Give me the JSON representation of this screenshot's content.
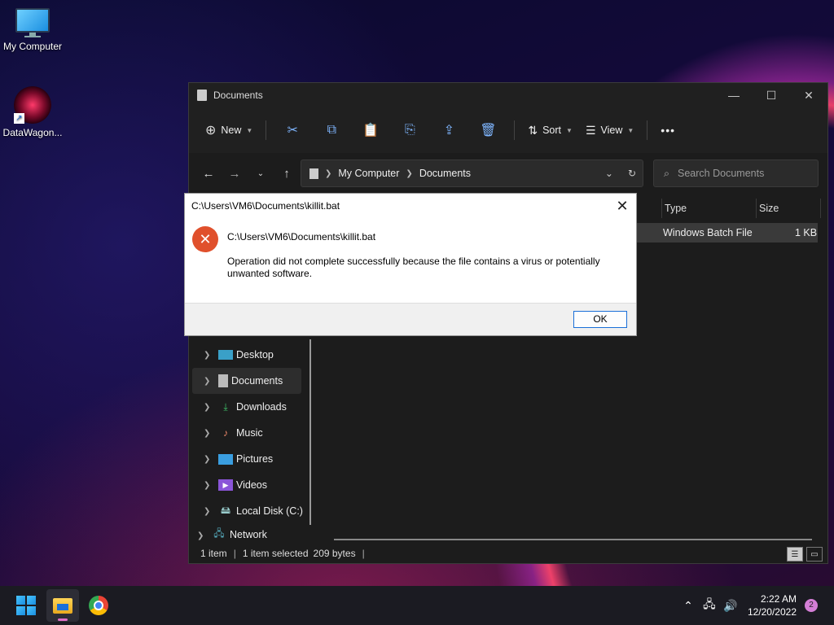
{
  "desktop": {
    "icons": [
      {
        "label": "My Computer"
      },
      {
        "label": "DataWagon..."
      }
    ]
  },
  "explorer": {
    "title": "Documents",
    "window_controls": {
      "minimize": "—",
      "maximize": "☐",
      "close": "✕"
    },
    "toolbar": {
      "new_label": "New",
      "sort_label": "Sort",
      "view_label": "View",
      "more_label": "•••"
    },
    "address": {
      "segments": [
        "My Computer",
        "Documents"
      ]
    },
    "search": {
      "placeholder": "Search Documents"
    },
    "columns": [
      "Type",
      "Size"
    ],
    "file": {
      "type": "Windows Batch File",
      "size": "1 KB"
    },
    "sidebar": {
      "items": [
        {
          "label": "Desktop"
        },
        {
          "label": "Documents"
        },
        {
          "label": "Downloads"
        },
        {
          "label": "Music"
        },
        {
          "label": "Pictures"
        },
        {
          "label": "Videos"
        },
        {
          "label": "Local Disk (C:)"
        },
        {
          "label": "Network"
        }
      ]
    },
    "status": {
      "items": "1 item",
      "selected": "1 item selected",
      "size": "209 bytes"
    }
  },
  "dialog": {
    "title": "C:\\Users\\VM6\\Documents\\killit.bat",
    "path": "C:\\Users\\VM6\\Documents\\killit.bat",
    "message": "Operation did not complete successfully because the file contains a virus or potentially unwanted software.",
    "ok_label": "OK",
    "close_glyph": "✕",
    "error_glyph": "✕"
  },
  "taskbar": {
    "time": "2:22 AM",
    "date": "12/20/2022",
    "notification_count": "2"
  },
  "colors": {
    "accent": "#1a6fd8",
    "error": "#e0502c",
    "window_bg": "#1c1c1c"
  }
}
